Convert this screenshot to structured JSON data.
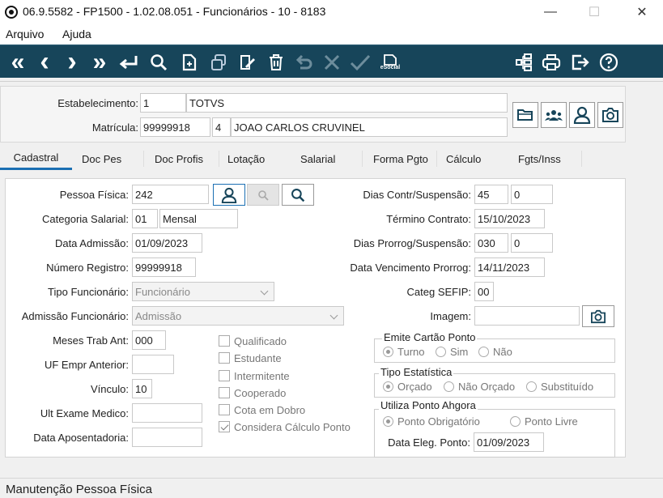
{
  "window": {
    "title": "06.9.5582 - FP1500 - 1.02.08.051 - Funcionários - 10 - 8183",
    "minimize": "—",
    "maximize": "☐",
    "close": "✕"
  },
  "menu": [
    {
      "label": "Arquivo"
    },
    {
      "label": "Ajuda"
    }
  ],
  "toolbar": {
    "first": "«",
    "prev": "‹",
    "next": "›",
    "last": "»",
    "esocial_label": "eSocial"
  },
  "header": {
    "estabelecimento_label": "Estabelecimento:",
    "estabelecimento_code": "1",
    "estabelecimento_name": "TOTVS",
    "matricula_label": "Matrícula:",
    "matricula_value": "99999918",
    "matricula_digit": "4",
    "matricula_name": "JOAO CARLOS CRUVINEL"
  },
  "tabs": [
    {
      "label": "Cadastral",
      "active": true
    },
    {
      "label": "Doc Pes"
    },
    {
      "label": "Doc Profis"
    },
    {
      "label": "Lotação"
    },
    {
      "label": "Salarial"
    },
    {
      "label": "Forma Pgto"
    },
    {
      "label": "Cálculo"
    },
    {
      "label": "Fgts/Inss"
    }
  ],
  "left": {
    "pessoa_fisica_label": "Pessoa Física:",
    "pessoa_fisica_value": "242",
    "categoria_label": "Categoria Salarial:",
    "categoria_code": "01",
    "categoria_desc": "Mensal",
    "data_admissao_label": "Data Admissão:",
    "data_admissao_value": "01/09/2023",
    "numero_registro_label": "Número Registro:",
    "numero_registro_value": "99999918",
    "tipo_funcionario_label": "Tipo Funcionário:",
    "tipo_funcionario_value": "Funcionário",
    "admissao_funcionario_label": "Admissão Funcionário:",
    "admissao_funcionario_value": "Admissão",
    "meses_trab_label": "Meses Trab Ant:",
    "meses_trab_value": "000",
    "uf_empr_label": "UF Empr Anterior:",
    "uf_empr_value": "",
    "vinculo_label": "Vínculo:",
    "vinculo_value": "10",
    "ult_exame_label": "Ult Exame Medico:",
    "ult_exame_value": "",
    "data_aposentadoria_label": "Data Aposentadoria:",
    "data_aposentadoria_value": ""
  },
  "checkboxes": [
    {
      "label": "Qualificado",
      "checked": false
    },
    {
      "label": "Estudante",
      "checked": false
    },
    {
      "label": "Intermitente",
      "checked": false
    },
    {
      "label": "Cooperado",
      "checked": false
    },
    {
      "label": "Cota em Dobro",
      "checked": false
    },
    {
      "label": "Considera Cálculo Ponto",
      "checked": true
    }
  ],
  "right": {
    "dias_contr_label": "Dias Contr/Suspensão:",
    "dias_contr_value1": "45",
    "dias_contr_value2": "0",
    "termino_label": "Término Contrato:",
    "termino_value": "15/10/2023",
    "dias_prorrog_label": "Dias Prorrog/Suspensão:",
    "dias_prorrog_value1": "030",
    "dias_prorrog_value2": "0",
    "data_venc_label": "Data Vencimento Prorrog:",
    "data_venc_value": "14/11/2023",
    "categ_sefip_label": "Categ SEFIP:",
    "categ_sefip_value": "00",
    "imagem_label": "Imagem:",
    "imagem_value": ""
  },
  "emite_cartao": {
    "title": "Emite Cartão Ponto",
    "options": [
      "Turno",
      "Sim",
      "Não"
    ],
    "selected": "Turno"
  },
  "tipo_estatistica": {
    "title": "Tipo Estatística",
    "options": [
      "Orçado",
      "Não Orçado",
      "Substituído"
    ],
    "selected": "Orçado"
  },
  "utiliza_ponto": {
    "title": "Utiliza Ponto Ahgora",
    "options": [
      "Ponto Obrigatório",
      "Ponto Livre"
    ],
    "selected": "Ponto Obrigatório",
    "data_eleg_label": "Data Eleg. Ponto:",
    "data_eleg_value": "01/09/2023"
  },
  "status": {
    "text": "Manutenção Pessoa Física"
  },
  "colors": {
    "toolbar_bg": "#17455a",
    "tab_active": "#1b6fb3"
  }
}
